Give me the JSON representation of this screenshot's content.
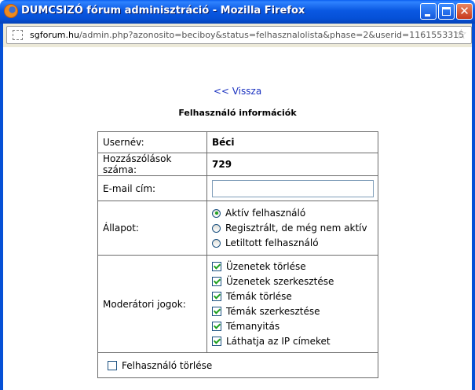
{
  "window": {
    "title": "DUMCSIZÓ fórum adminisztráció - Mozilla Firefox",
    "url_domain": "sgforum.hu",
    "url_path": "/admin.php?azonosito=beciboy&status=felhasznalolista&phase=2&userid=1161553315"
  },
  "page": {
    "back_link": "<< Vissza",
    "heading": "Felhasználó információk"
  },
  "user": {
    "username_label": "Usernév:",
    "username_value": "Béci",
    "posts_label": "Hozzászólások száma:",
    "posts_value": "729",
    "email_label": "E-mail cím:",
    "email_value": "",
    "status_label": "Állapot:",
    "status_options": [
      {
        "label": "Aktív felhasználó",
        "selected": true
      },
      {
        "label": "Regisztrált, de még nem aktív",
        "selected": false
      },
      {
        "label": "Letiltott felhasználó",
        "selected": false
      }
    ],
    "rights_label": "Moderátori jogok:",
    "rights": [
      {
        "label": "Üzenetek törlése",
        "checked": true
      },
      {
        "label": "Üzenetek szerkesztése",
        "checked": true
      },
      {
        "label": "Témák törlése",
        "checked": true
      },
      {
        "label": "Témák szerkesztése",
        "checked": true
      },
      {
        "label": "Témanyitás",
        "checked": true
      },
      {
        "label": "Láthatja az IP címeket",
        "checked": true
      }
    ],
    "delete_label": "Felhasználó törlése",
    "delete_checked": false
  },
  "colors": {
    "titlebar": "#0550d6",
    "link": "#1b32c0",
    "check_green": "#21a121"
  }
}
